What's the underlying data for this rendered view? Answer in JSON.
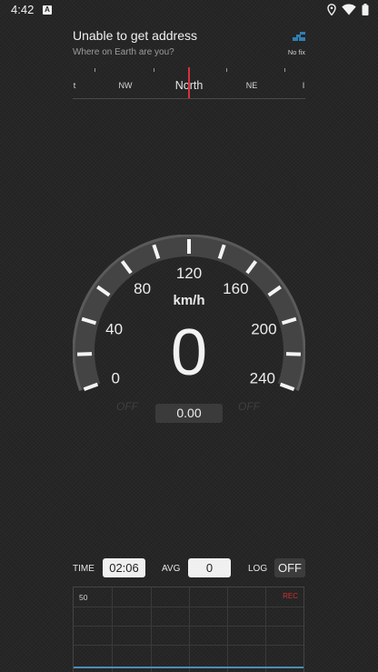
{
  "status_bar": {
    "time": "4:42",
    "notification_letter": "A"
  },
  "address": {
    "title": "Unable to get address",
    "subtitle": "Where on Earth are you?",
    "fix_status": "No fix"
  },
  "compass": {
    "labels": [
      "t",
      "NW",
      "North",
      "NE",
      "I"
    ]
  },
  "gauge": {
    "unit": "km/h",
    "speed": "0",
    "scale_labels": [
      "0",
      "40",
      "80",
      "120",
      "160",
      "200",
      "240"
    ],
    "off_left": "OFF",
    "off_right": "OFF",
    "distance": "0.00"
  },
  "bottom_bar": {
    "time_label": "TIME",
    "time_value": "02:06",
    "avg_label": "AVG",
    "avg_value": "0",
    "log_label": "LOG",
    "log_value": "OFF"
  },
  "chart": {
    "y_max": "50",
    "rec_label": "REC"
  },
  "colors": {
    "needle": "#d6323b",
    "rec": "#d0302f",
    "baseline": "#4c8db6"
  }
}
